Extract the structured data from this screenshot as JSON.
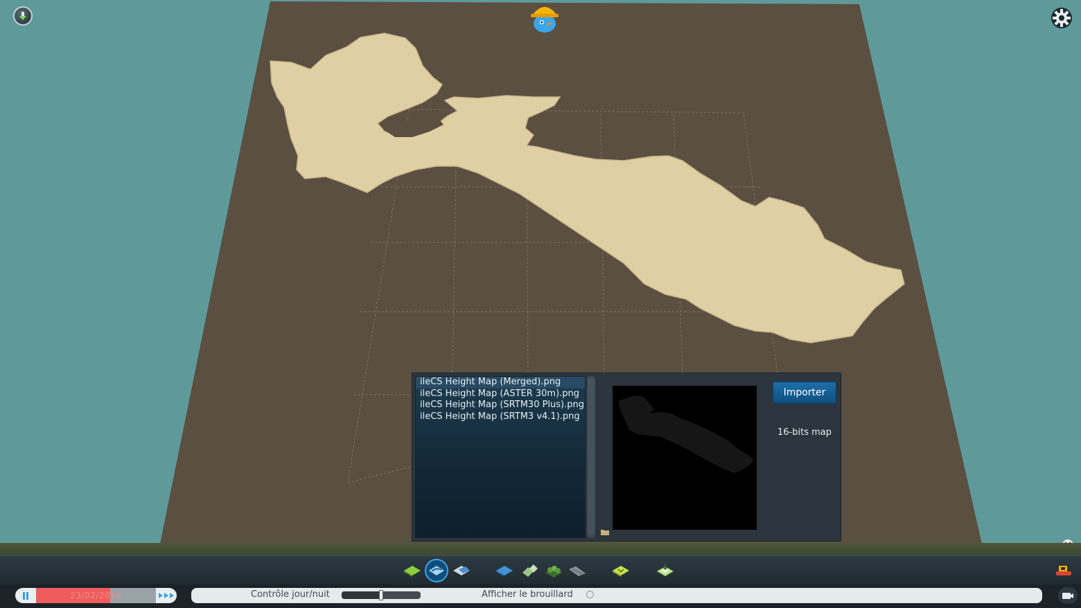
{
  "import_panel": {
    "files": [
      {
        "name": "ileCS Height Map (Merged).png",
        "selected": true
      },
      {
        "name": "ileCS Height Map (ASTER 30m).png",
        "selected": false
      },
      {
        "name": "ileCS Height Map (SRTM30 Plus).png",
        "selected": false
      },
      {
        "name": "ileCS Height Map (SRTM3 v4.1).png",
        "selected": false
      }
    ],
    "import_label": "Importer",
    "bit_depth_label": "16-bits map"
  },
  "status_bar": {
    "date": "23/02/2016",
    "date_progress": 0.62,
    "daynight_label": "Contrôle jour/nuit",
    "daynight_value": 0.5,
    "fog_label": "Afficher le brouillard",
    "fog_enabled": false
  },
  "toolbar": {
    "tools": [
      {
        "name": "landscaping-tool-button",
        "icon": "terrain-raise-icon",
        "active": false
      },
      {
        "name": "ditch-tool-button",
        "icon": "terrain-ditch-icon",
        "active": true
      },
      {
        "name": "terrain-level-button",
        "icon": "terrain-level-icon",
        "active": false
      },
      {
        "name": "water-tool-button",
        "icon": "water-icon",
        "active": false
      },
      {
        "name": "ore-resource-button",
        "icon": "ore-icon",
        "active": false
      },
      {
        "name": "trees-button",
        "icon": "tree-icon",
        "active": false
      },
      {
        "name": "rocks-button",
        "icon": "rock-icon",
        "active": false
      },
      {
        "name": "map-settings-button",
        "icon": "map-icon",
        "active": false
      },
      {
        "name": "heightmap-import-button",
        "icon": "heightmap-icon",
        "active": false
      }
    ]
  },
  "colors": {
    "background": "#5f9a9a",
    "terrain_ground": "#5a4f41",
    "island_sand": "#e0cfa3",
    "accent_blue": "#1b6fa8",
    "date_progress": "#ef5c5c"
  }
}
